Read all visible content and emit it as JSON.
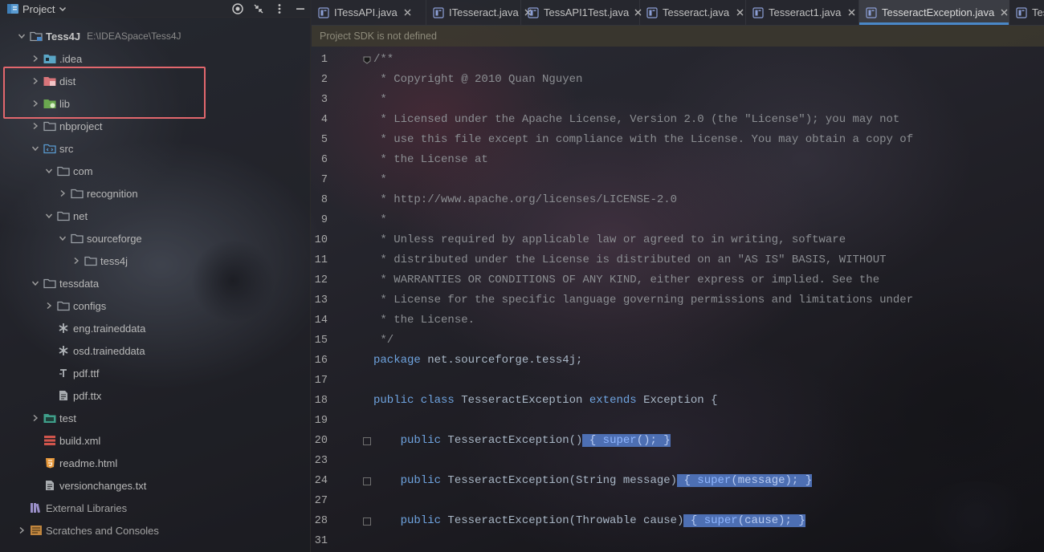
{
  "project_pane": {
    "title": "Project",
    "tree": [
      {
        "label": "Tess4J",
        "path": "E:\\IDEASpace\\Tess4J",
        "icon": "module-folder-icon",
        "expanded": true,
        "depth": 0
      },
      {
        "label": ".idea",
        "icon": "idea-folder-icon",
        "expanded": false,
        "depth": 1
      },
      {
        "label": "dist",
        "icon": "excluded-folder-icon",
        "expanded": false,
        "depth": 1
      },
      {
        "label": "lib",
        "icon": "library-folder-icon",
        "expanded": false,
        "depth": 1
      },
      {
        "label": "nbproject",
        "icon": "folder-icon",
        "expanded": false,
        "depth": 1
      },
      {
        "label": "src",
        "icon": "source-folder-icon",
        "expanded": true,
        "depth": 1
      },
      {
        "label": "com",
        "icon": "folder-icon",
        "expanded": true,
        "depth": 2
      },
      {
        "label": "recognition",
        "icon": "folder-icon",
        "expanded": false,
        "depth": 3
      },
      {
        "label": "net",
        "icon": "folder-icon",
        "expanded": true,
        "depth": 2
      },
      {
        "label": "sourceforge",
        "icon": "folder-icon",
        "expanded": true,
        "depth": 3
      },
      {
        "label": "tess4j",
        "icon": "folder-icon",
        "expanded": false,
        "depth": 4
      },
      {
        "label": "tessdata",
        "icon": "folder-icon",
        "expanded": true,
        "depth": 1
      },
      {
        "label": "configs",
        "icon": "folder-icon",
        "expanded": false,
        "depth": 2
      },
      {
        "label": "eng.traineddata",
        "icon": "asterisk-file-icon",
        "depth": 2
      },
      {
        "label": "osd.traineddata",
        "icon": "asterisk-file-icon",
        "depth": 2
      },
      {
        "label": "pdf.ttf",
        "icon": "font-file-icon",
        "depth": 2
      },
      {
        "label": "pdf.ttx",
        "icon": "text-file-icon",
        "depth": 2
      },
      {
        "label": "test",
        "icon": "test-folder-icon",
        "expanded": false,
        "depth": 1
      },
      {
        "label": "build.xml",
        "icon": "ant-build-icon",
        "depth": 1
      },
      {
        "label": "readme.html",
        "icon": "html5-icon",
        "depth": 1
      },
      {
        "label": "versionchanges.txt",
        "icon": "text-file-icon",
        "depth": 1
      },
      {
        "label": "External Libraries",
        "icon": "external-libraries-icon",
        "depth": 0
      },
      {
        "label": "Scratches and Consoles",
        "icon": "scratches-icon",
        "expanded": false,
        "depth": 0
      }
    ]
  },
  "tabs": [
    {
      "label": "ITessAPI.java",
      "active": false
    },
    {
      "label": "ITesseract.java",
      "active": false
    },
    {
      "label": "TessAPI1Test.java",
      "active": false
    },
    {
      "label": "Tesseract.java",
      "active": false
    },
    {
      "label": "Tesseract1.java",
      "active": false
    },
    {
      "label": "TesseractException.java",
      "active": true
    },
    {
      "label": "Tes",
      "active": false
    }
  ],
  "notice": {
    "text": "Project SDK is not defined"
  },
  "editor": {
    "lines": [
      {
        "number": "1",
        "fold": true,
        "tokens": [
          {
            "t": "/**",
            "c": "comment"
          }
        ]
      },
      {
        "number": "2",
        "tokens": [
          {
            "t": " * Copyright @ 2010 Quan Nguyen",
            "c": "comment"
          }
        ]
      },
      {
        "number": "3",
        "tokens": [
          {
            "t": " *",
            "c": "comment"
          }
        ]
      },
      {
        "number": "4",
        "tokens": [
          {
            "t": " * Licensed under the Apache License, Version 2.0 (the \"License\"); you may not",
            "c": "comment"
          }
        ]
      },
      {
        "number": "5",
        "tokens": [
          {
            "t": " * use this file except in compliance with the License. You may obtain a copy of",
            "c": "comment"
          }
        ]
      },
      {
        "number": "6",
        "tokens": [
          {
            "t": " * the License at",
            "c": "comment"
          }
        ]
      },
      {
        "number": "7",
        "tokens": [
          {
            "t": " *",
            "c": "comment"
          }
        ]
      },
      {
        "number": "8",
        "tokens": [
          {
            "t": " * http://www.apache.org/licenses/LICENSE-2.0",
            "c": "comment"
          }
        ]
      },
      {
        "number": "9",
        "tokens": [
          {
            "t": " *",
            "c": "comment"
          }
        ]
      },
      {
        "number": "10",
        "tokens": [
          {
            "t": " * Unless required by applicable law or agreed to in writing, software",
            "c": "comment"
          }
        ]
      },
      {
        "number": "11",
        "tokens": [
          {
            "t": " * distributed under the License is distributed on an \"AS IS\" BASIS, WITHOUT",
            "c": "comment"
          }
        ]
      },
      {
        "number": "12",
        "tokens": [
          {
            "t": " * WARRANTIES OR CONDITIONS OF ANY KIND, either express or implied. See the",
            "c": "comment"
          }
        ]
      },
      {
        "number": "13",
        "tokens": [
          {
            "t": " * License for the specific language governing permissions and limitations under",
            "c": "comment"
          }
        ]
      },
      {
        "number": "14",
        "tokens": [
          {
            "t": " * the License.",
            "c": "comment"
          }
        ]
      },
      {
        "number": "15",
        "tokens": [
          {
            "t": " */",
            "c": "comment"
          }
        ]
      },
      {
        "number": "16",
        "tokens": [
          {
            "t": "package ",
            "c": "kw"
          },
          {
            "t": "net.sourceforge.tess4j;",
            "c": "plain"
          }
        ]
      },
      {
        "number": "17",
        "tokens": []
      },
      {
        "number": "18",
        "tokens": [
          {
            "t": "public class ",
            "c": "kw"
          },
          {
            "t": "TesseractException ",
            "c": "plain"
          },
          {
            "t": "extends ",
            "c": "kw"
          },
          {
            "t": "Exception {",
            "c": "plain"
          }
        ]
      },
      {
        "number": "19",
        "tokens": []
      },
      {
        "number": "20",
        "fold": true,
        "tokens": [
          {
            "t": "    ",
            "c": "plain"
          },
          {
            "t": "public ",
            "c": "kw"
          },
          {
            "t": "TesseractException()",
            "c": "plain"
          },
          {
            "t": " { ",
            "c": "hl"
          },
          {
            "t": "super",
            "c": "hlkw"
          },
          {
            "t": "(); ",
            "c": "hl"
          },
          {
            "t": "}",
            "c": "hl"
          }
        ]
      },
      {
        "number": "23",
        "tokens": []
      },
      {
        "number": "24",
        "fold": true,
        "tokens": [
          {
            "t": "    ",
            "c": "plain"
          },
          {
            "t": "public ",
            "c": "kw"
          },
          {
            "t": "TesseractException(String message)",
            "c": "plain"
          },
          {
            "t": " { ",
            "c": "hl"
          },
          {
            "t": "super",
            "c": "hlkw"
          },
          {
            "t": "(message); ",
            "c": "hl"
          },
          {
            "t": "}",
            "c": "hl"
          }
        ]
      },
      {
        "number": "27",
        "tokens": []
      },
      {
        "number": "28",
        "fold": true,
        "tokens": [
          {
            "t": "    ",
            "c": "plain"
          },
          {
            "t": "public ",
            "c": "kw"
          },
          {
            "t": "TesseractException(Throwable cause)",
            "c": "plain"
          },
          {
            "t": " { ",
            "c": "hl"
          },
          {
            "t": "super",
            "c": "hlkw"
          },
          {
            "t": "(cause); ",
            "c": "hl"
          },
          {
            "t": "}",
            "c": "hl"
          }
        ]
      },
      {
        "number": "31",
        "tokens": []
      }
    ]
  },
  "colors": {
    "accent": "#4a88c7",
    "highlight_box": "#e2676d",
    "keyword": "#6fa4e0",
    "comment": "#8b8e92"
  }
}
